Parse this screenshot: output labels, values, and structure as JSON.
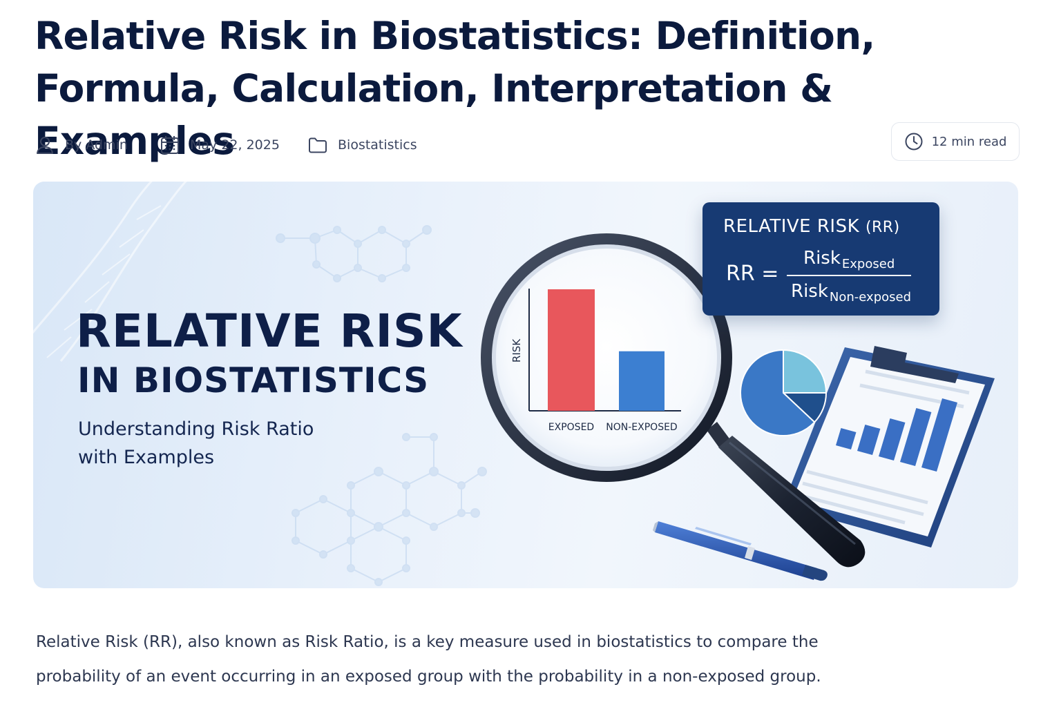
{
  "article": {
    "title": "Relative Risk in Biostatistics: Definition, Formula, Calculation, Interpretation & Examples"
  },
  "meta": {
    "author": "By Admin",
    "date": "May 22, 2025",
    "category": "Biostatistics",
    "read_time": "12 min read"
  },
  "hero": {
    "heading_line1": "RELATIVE RISK",
    "heading_line2": "IN BIOSTATISTICS",
    "subtitle": "Understanding Risk Ratio with Examples",
    "formula": {
      "title": "RELATIVE RISK",
      "title_abbr": "(RR)",
      "lhs": "RR =",
      "numerator": "Risk",
      "numerator_sub": "Exposed",
      "denominator": "Risk",
      "denominator_sub": "Non-exposed"
    },
    "magnifier_chart": {
      "ylabel": "RISK",
      "categories": [
        "EXPOSED",
        "NON-EXPOSED"
      ],
      "relative_values": [
        1.0,
        0.49
      ],
      "colors": [
        "#e8575c",
        "#3c7fd1"
      ]
    },
    "clipboard_chart": {
      "relative_values": [
        0.25,
        0.38,
        0.55,
        0.78,
        1.0
      ],
      "color": "#3a6fc4"
    },
    "pie_chart": {
      "slices": [
        0.25,
        0.12,
        0.63
      ],
      "colors": [
        "#79c3dd",
        "#1f4f8c",
        "#3a78c6"
      ]
    }
  },
  "intro_text": "Relative Risk (RR), also known as Risk Ratio, is a key measure used in biostatistics to compare the probability of an event occurring in an exposed group with the probability in a non-exposed group."
}
